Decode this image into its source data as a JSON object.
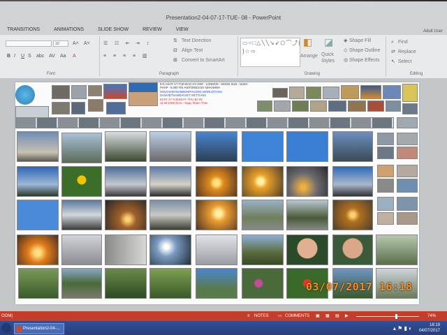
{
  "window": {
    "title": "Presentation2-04-07-17-TUE- 08 - PowerPoint",
    "account": "Adult User"
  },
  "tabs": [
    "TRANSITIONS",
    "ANIMATIONS",
    "SLIDE SHOW",
    "REVIEW",
    "VIEW"
  ],
  "ribbon": {
    "font_label": "Font",
    "font_size": "10",
    "paragraph_label": "Paragraph",
    "text_direction": "Text Direction",
    "align_text": "Align Text",
    "convert_smartart": "Convert to SmartArt",
    "drawing_label": "Drawing",
    "arrange": "Arrange",
    "quick_styles": "Quick Styles",
    "shape_fill": "Shape Fill",
    "shape_outline": "Shape Outline",
    "shape_effects": "Shape Effects",
    "editing_label": "Editing",
    "find": "Find",
    "replace": "Replace",
    "select": "Select"
  },
  "slide_info": {
    "line1": "571-04-07-17-TUE-BAO HV HNP - LONDON - MOON SUN - NUEC",
    "line2": "PHAP - 5,000 TIN HISTORIES BY NHANHNH",
    "line3": "NGUOIVIETNAMBONPHUONG.WORLDTIANS",
    "line4": "DANVIETNAMDAIVIET.VIETTIANS",
    "line5": "04-07-17-TUESDAY- THU BA 08",
    "line6": "11-06 DINH DAU - Ngay Nham Than"
  },
  "status": {
    "left": "OOM)",
    "notes": "NOTES",
    "comments": "COMMENTS",
    "zoom": "74%"
  },
  "taskbar": {
    "app": "Presentation2-04-...",
    "time": "18:19",
    "date": "04/07/2017"
  },
  "camera_stamp": "03/07/2017  16:18",
  "colors": {
    "accent": "#c43d2b",
    "taskbar": "#2a3d78",
    "stamp": "#ff8a1c"
  }
}
